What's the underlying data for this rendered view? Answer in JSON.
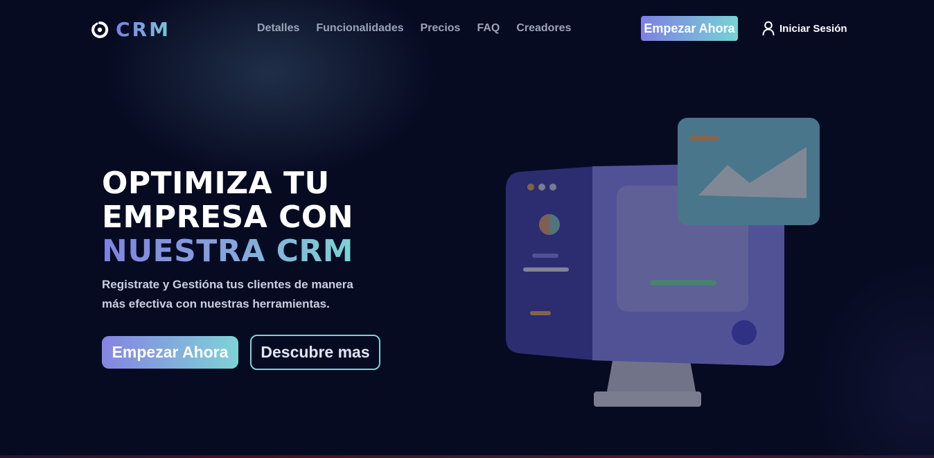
{
  "brand": {
    "name": "CRM",
    "logo_icon": "spiral-logo-icon"
  },
  "nav": {
    "items": [
      {
        "label": "Detalles"
      },
      {
        "label": "Funcionalidades"
      },
      {
        "label": "Precios"
      },
      {
        "label": "FAQ"
      },
      {
        "label": "Creadores"
      }
    ],
    "cta_label": "Empezar Ahora",
    "login_label": "Iniciar Sesión",
    "login_icon": "user-icon"
  },
  "hero": {
    "title_line1": "OPTIMIZA TU",
    "title_line2": "EMPRESA CON",
    "title_line3": "NUESTRA CRM",
    "subtitle": "Registrate y Gestióna tus clientes de manera más efectiva con nuestras herramientas.",
    "primary_button": "Empezar Ahora",
    "secondary_button": "Descubre mas",
    "illustration_icon": "computer-monitor-illustration"
  },
  "colors": {
    "background": "#070b22",
    "accent_start": "#7e80e2",
    "accent_end": "#78d2d6",
    "nav_text": "#9aa3b8"
  }
}
